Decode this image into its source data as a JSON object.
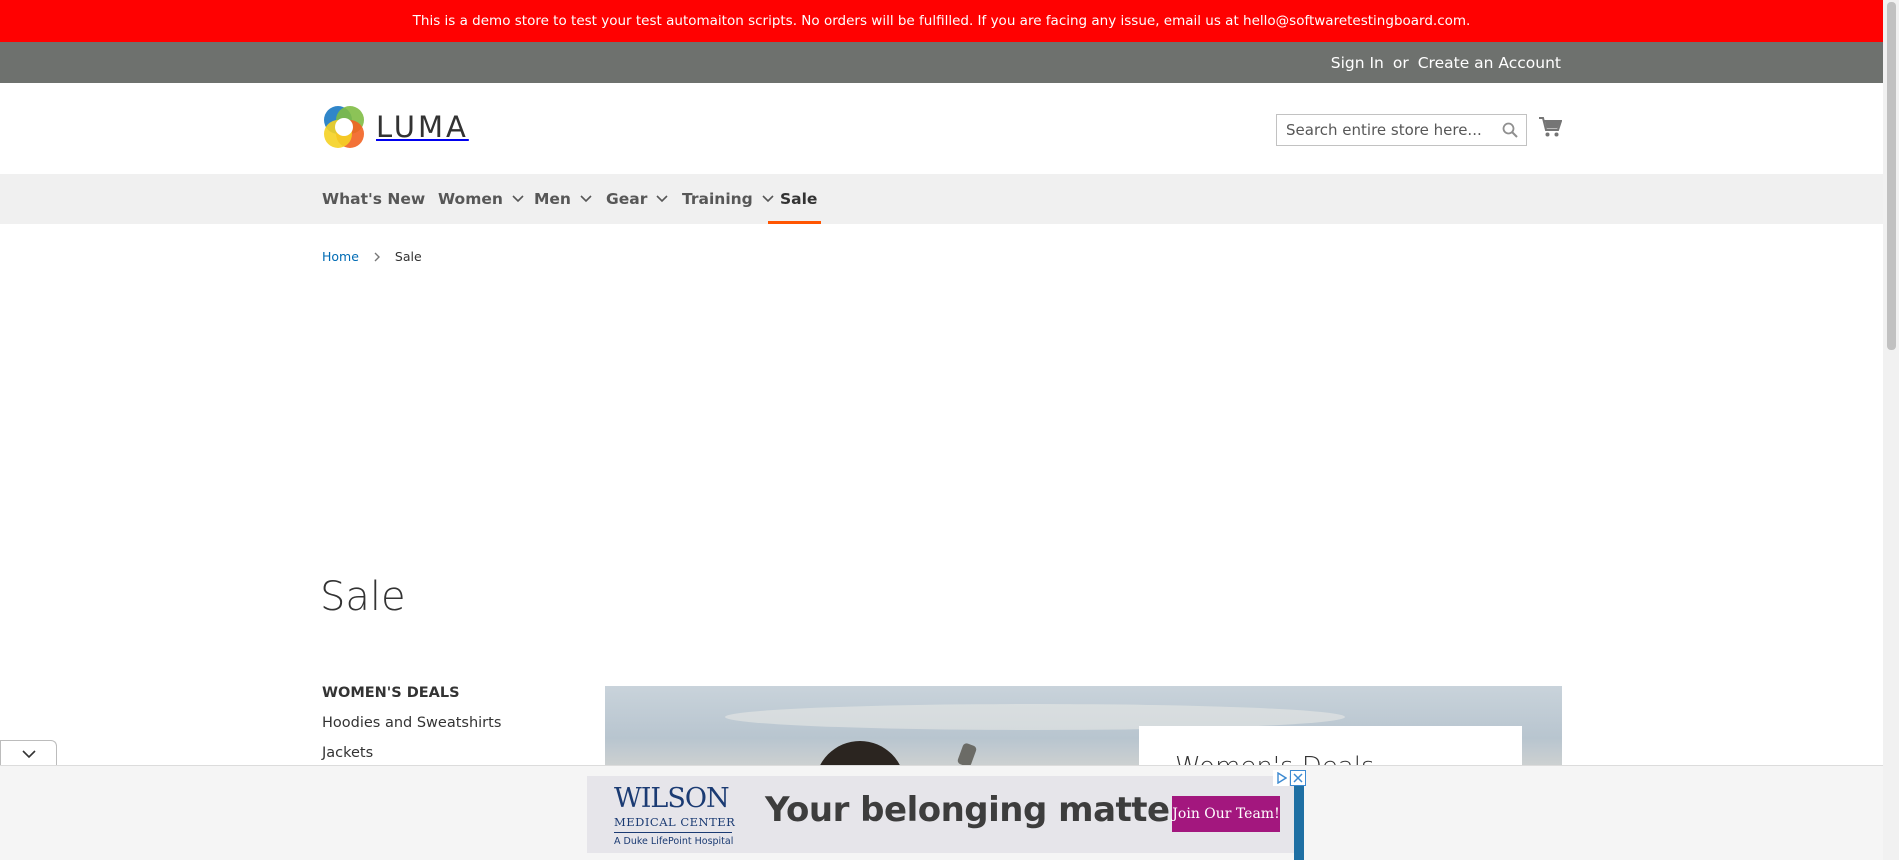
{
  "demo_notice": "This is a demo store to test your test automaiton scripts. No orders will be fulfilled. If you are facing any issue, email us at hello@softwaretestingboard.com.",
  "header_links": {
    "sign_in": "Sign In",
    "or": "or",
    "create_account": "Create an Account"
  },
  "logo": {
    "text": "LUMA"
  },
  "search": {
    "placeholder": "Search entire store here...",
    "value": ""
  },
  "nav": {
    "items": [
      {
        "label": "What's New"
      },
      {
        "label": "Women"
      },
      {
        "label": "Men"
      },
      {
        "label": "Gear"
      },
      {
        "label": "Training"
      },
      {
        "label": "Sale"
      }
    ],
    "active": "Sale"
  },
  "breadcrumb": {
    "home": "Home",
    "current": "Sale"
  },
  "page_title": "Sale",
  "sidebar": {
    "heading": "WOMEN'S DEALS",
    "links": [
      "Hoodies and Sweatshirts",
      "Jackets"
    ]
  },
  "promo": {
    "title": "Women's Deals"
  },
  "ad": {
    "logo_name": "WILSON",
    "logo_sub": "MEDICAL CENTER",
    "logo_tag": "A Duke LifePoint Hospital",
    "headline": "Your belonging matters.",
    "cta": "Join Our Team!"
  },
  "colors": {
    "demo_bar": "#ff0101",
    "header_bar": "#6e716e",
    "nav_bg": "#f0f0f0",
    "active_underline": "#ff5501",
    "link_blue": "#006bb4"
  }
}
